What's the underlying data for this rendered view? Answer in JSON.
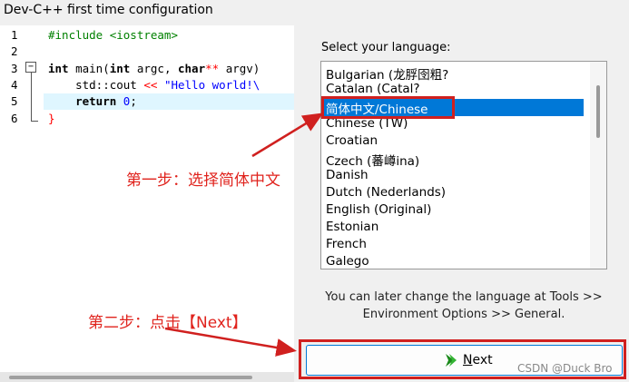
{
  "window": {
    "title": "Dev-C++ first time configuration"
  },
  "editor": {
    "line_numbers": [
      "1",
      "2",
      "3",
      "4",
      "5",
      "6"
    ],
    "fold_symbol": "−",
    "lines": [
      {
        "segments": [
          {
            "t": "#include <iostream>",
            "c": "pp"
          }
        ]
      },
      {
        "segments": []
      },
      {
        "segments": [
          {
            "t": "int",
            "c": "kw"
          },
          {
            "t": " main(",
            "c": ""
          },
          {
            "t": "int",
            "c": "kw"
          },
          {
            "t": " argc, ",
            "c": ""
          },
          {
            "t": "char",
            "c": "kw"
          },
          {
            "t": "**",
            "c": "op"
          },
          {
            "t": " argv)",
            "c": ""
          }
        ]
      },
      {
        "segments": [
          {
            "t": "    std::cout ",
            "c": ""
          },
          {
            "t": "<<",
            "c": "op"
          },
          {
            "t": " ",
            "c": ""
          },
          {
            "t": "\"Hello world!\\",
            "c": "str"
          }
        ]
      },
      {
        "segments": [
          {
            "t": "    return ",
            "c": "kw"
          },
          {
            "t": "0",
            "c": "str"
          },
          {
            "t": ";",
            "c": ""
          }
        ]
      },
      {
        "segments": [
          {
            "t": "}",
            "c": "op"
          }
        ]
      }
    ]
  },
  "language": {
    "label": "Select your language:",
    "items": [
      "Bulgarian (龙脬囹粗?",
      "Catalan (Catal?",
      "简体中文/Chinese",
      "Chinese (TW)",
      "Croatian",
      "Czech (蕃嶟ina)",
      "Danish",
      "Dutch (Nederlands)",
      "English (Original)",
      "Estonian",
      "French",
      "Galego"
    ],
    "selected_index": 2
  },
  "info": {
    "line1": "You can later change the language at Tools >>",
    "line2": "Environment Options >> General."
  },
  "buttons": {
    "next": "Next"
  },
  "annotations": {
    "step1": "第一步：选择简体中文",
    "step2": "第二步：点击【Next】",
    "color": "#d0201f"
  },
  "watermark": "CSDN @Duck Bro"
}
